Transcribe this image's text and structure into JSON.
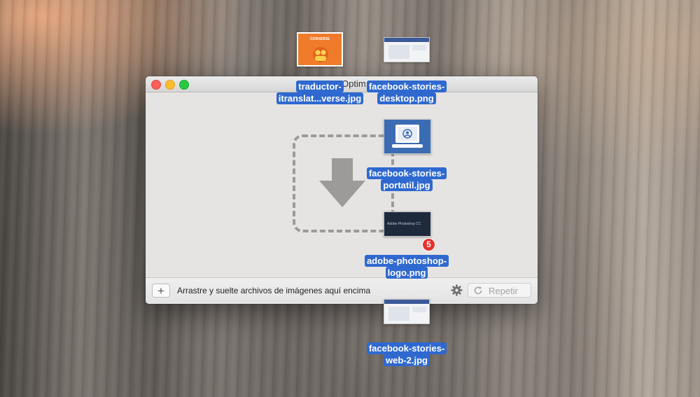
{
  "window": {
    "title": "Optim",
    "hint": "Arrastre y suelte archivos de imágenes aquí encima",
    "add_label": "+",
    "repeat_label": "Repetir"
  },
  "files": [
    {
      "line1": "traductor-",
      "line2": "itranslat...verse.jpg",
      "thumb_text": "CONVERSE"
    },
    {
      "line1": "facebook-stories-",
      "line2": "desktop.png"
    },
    {
      "line1": "facebook-stories-",
      "line2": "portatil.jpg"
    },
    {
      "line1": "adobe-photoshop-",
      "line2": "logo.png",
      "thumb_text": "Adobe Photoshop CC"
    },
    {
      "line1": "facebook-stories-",
      "line2": "web-2.jpg"
    }
  ],
  "drag_count": "5",
  "colors": {
    "selection": "#2f69d0",
    "badge": "#e5322d",
    "close": "#fc5f57",
    "minimize": "#fdbc2e",
    "zoom": "#28c840"
  }
}
